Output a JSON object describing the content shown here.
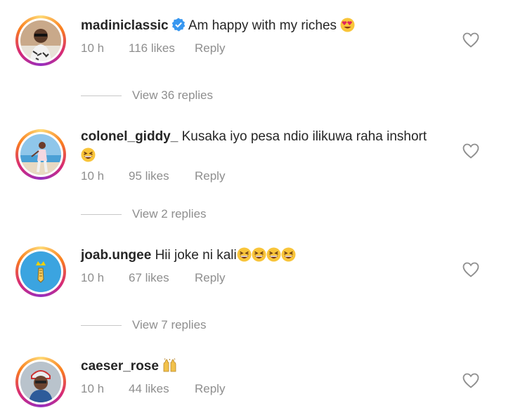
{
  "comments": [
    {
      "username": "madiniclassic",
      "verified": true,
      "text": "Am happy with my riches",
      "emoji": [
        "heart-eyes"
      ],
      "time": "10 h",
      "likes": "116 likes",
      "reply": "Reply",
      "view_replies": "View 36 replies"
    },
    {
      "username": "colonel_giddy_",
      "text": "Kusaka iyo pesa ndio ilikuwa raha inshort",
      "emoji": [
        "grinning-squint"
      ],
      "time": "10 h",
      "likes": "95 likes",
      "reply": "Reply",
      "view_replies": "View 2 replies"
    },
    {
      "username": "joab.ungee",
      "text": "Hii joke ni kali",
      "emoji": [
        "grinning-squint",
        "grinning-squint",
        "grinning-squint",
        "grinning-squint"
      ],
      "time": "10 h",
      "likes": "67 likes",
      "reply": "Reply",
      "view_replies": "View 7 replies"
    },
    {
      "username": "caeser_rose",
      "text": "",
      "emoji": [
        "raising-hands"
      ],
      "time": "10 h",
      "likes": "44 likes",
      "reply": "Reply"
    }
  ],
  "colors": {
    "text": "#262626",
    "muted": "#8e8e8e",
    "verified_blue": "#3897f0"
  }
}
